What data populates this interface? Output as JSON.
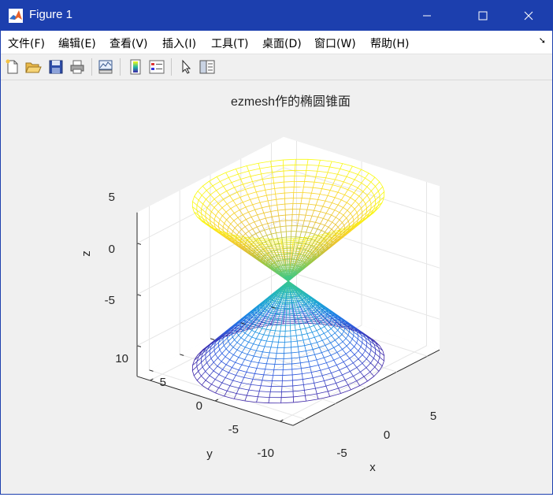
{
  "window": {
    "title": "Figure 1"
  },
  "menu": [
    "文件(F)",
    "编辑(E)",
    "查看(V)",
    "插入(I)",
    "工具(T)",
    "桌面(D)",
    "窗口(W)",
    "帮助(H)"
  ],
  "toolbar_icons": [
    "new-figure-icon",
    "open-file-icon",
    "save-icon",
    "print-icon",
    "link-plot-icon",
    "insert-colorbar-icon",
    "insert-legend-icon",
    "edit-plot-pointer-icon",
    "property-editor-icon"
  ],
  "plot": {
    "title": "ezmesh作的椭圆锥面",
    "xlabel": "x",
    "ylabel": "y",
    "zlabel": "z",
    "xticks": [
      "-5",
      "0",
      "5"
    ],
    "yticks": [
      "-10",
      "-5",
      "0",
      "5",
      "10"
    ],
    "zticks": [
      "-5",
      "0",
      "5"
    ]
  },
  "chart_data": {
    "type": "mesh",
    "function": "elliptic cone surface (double nappe)",
    "title": "ezmesh作的椭圆锥面",
    "xlabel": "x",
    "ylabel": "y",
    "zlabel": "z",
    "xlim": [
      -6,
      6
    ],
    "ylim": [
      -12,
      12
    ],
    "zlim": [
      -8,
      8
    ],
    "xticks": [
      -5,
      0,
      5
    ],
    "yticks": [
      -10,
      -5,
      0,
      5,
      10
    ],
    "zticks": [
      -5,
      0,
      5
    ],
    "grid": true,
    "colormap": "parula"
  }
}
